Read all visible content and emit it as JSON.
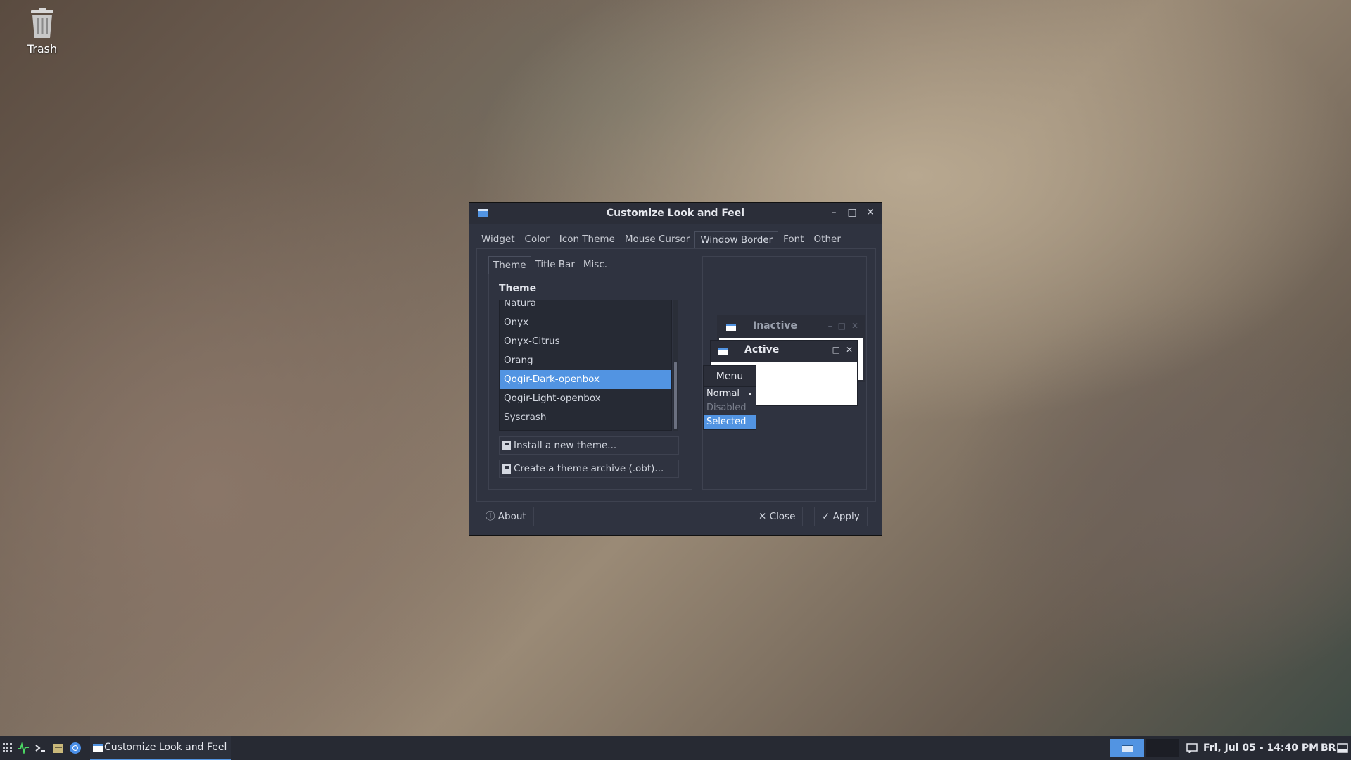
{
  "desktop": {
    "trash_label": "Trash"
  },
  "window": {
    "title": "Customize Look and Feel",
    "tabs": [
      "Widget",
      "Color",
      "Icon Theme",
      "Mouse Cursor",
      "Window Border",
      "Font",
      "Other"
    ],
    "active_tab": "Window Border",
    "subtabs": [
      "Theme",
      "Title Bar",
      "Misc."
    ],
    "active_subtab": "Theme",
    "section_title": "Theme",
    "themes": [
      "Natura",
      "Onyx",
      "Onyx-Citrus",
      "Orang",
      "Qogir-Dark-openbox",
      "Qogir-Light-openbox",
      "Syscrash"
    ],
    "selected_theme": "Qogir-Dark-openbox",
    "install_label": "Install a new theme...",
    "archive_label": "Create a theme archive (.obt)...",
    "preview": {
      "inactive_title": "Inactive",
      "active_title": "Active",
      "menu_title": "Menu",
      "menu_items": [
        "Normal",
        "Disabled",
        "Selected"
      ]
    },
    "about_label": "About",
    "close_label": "Close",
    "apply_label": "Apply"
  },
  "taskbar": {
    "task_label": "Customize Look and Feel",
    "clock": "Fri, Jul 05 - 14:40 PM",
    "keyboard_layout": "BR"
  },
  "colors": {
    "accent": "#5294e2",
    "window_bg": "#2f3340",
    "titlebar_bg": "#2b2e39",
    "taskbar_bg": "#272a33"
  }
}
